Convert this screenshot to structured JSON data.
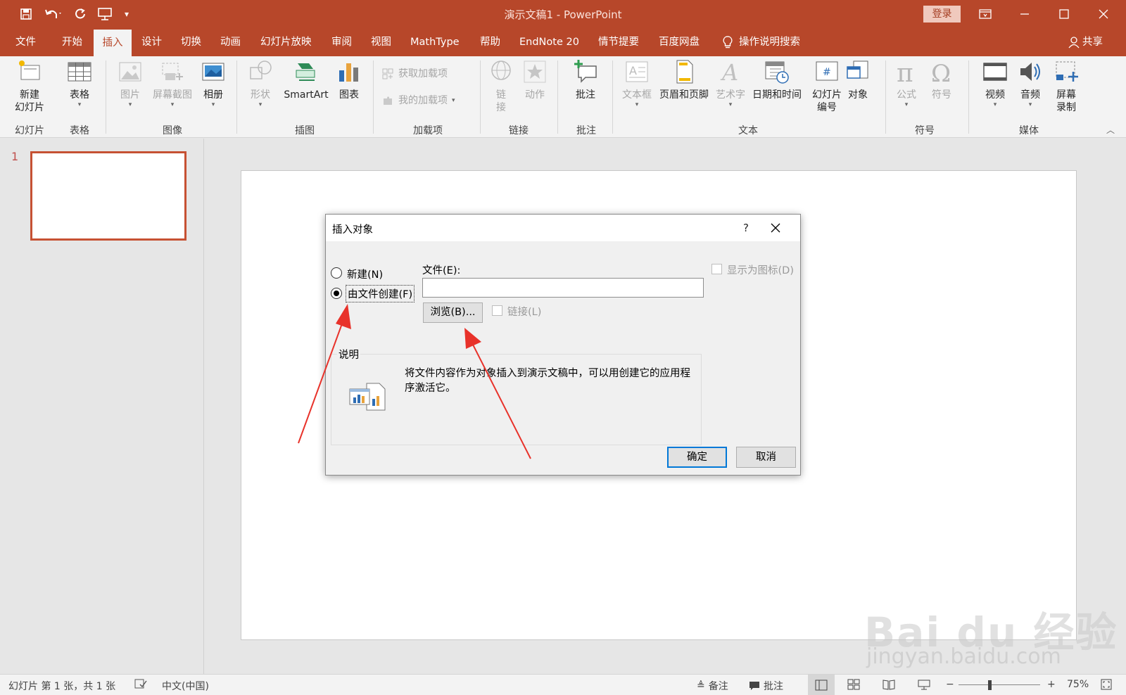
{
  "window": {
    "title": "演示文稿1  -  PowerPoint",
    "login": "登录",
    "share": "共享"
  },
  "tabs": [
    "文件",
    "开始",
    "插入",
    "设计",
    "切换",
    "动画",
    "幻灯片放映",
    "审阅",
    "视图",
    "MathType",
    "帮助",
    "EndNote 20",
    "情节提要",
    "百度网盘"
  ],
  "active_tab": "插入",
  "tell_me": "操作说明搜索",
  "ribbon": {
    "new_slide": "新建\n幻灯片",
    "table": "表格",
    "picture": "图片",
    "screenshot": "屏幕截图",
    "album": "相册",
    "shapes": "形状",
    "smartart": "SmartArt",
    "chart": "图表",
    "get_addins": "获取加载项",
    "my_addins": "我的加载项",
    "link": "链\n接",
    "action": "动作",
    "comment": "批注",
    "textbox": "文本框",
    "header_footer": "页眉和页脚",
    "wordart": "艺术字",
    "datetime": "日期和时间",
    "slide_number": "幻灯片\n编号",
    "object": "对象",
    "equation": "公式",
    "symbol": "符号",
    "video": "视频",
    "audio": "音频",
    "screen_recording": "屏幕\n录制",
    "groups": {
      "slides": "幻灯片",
      "tables": "表格",
      "images": "图像",
      "illustrations": "插图",
      "addins": "加载项",
      "links": "链接",
      "comments": "批注",
      "text": "文本",
      "symbols": "符号",
      "media": "媒体"
    }
  },
  "thumbnail": {
    "number": "1"
  },
  "dialog": {
    "title": "插入对象",
    "help": "?",
    "radio_new": "新建(N)",
    "radio_from_file": "由文件创建(F)",
    "file_label": "文件(E):",
    "file_value": "",
    "browse": "浏览(B)...",
    "link": "链接(L)",
    "display_as_icon": "显示为图标(D)",
    "desc_label": "说明",
    "desc_text": "将文件内容作为对象插入到演示文稿中，可以用创建它的应用程序激活它。",
    "ok": "确定",
    "cancel": "取消"
  },
  "watermark": {
    "logo": "Bai du 经验",
    "url": "jingyan.baidu.com"
  },
  "status": {
    "slide_info": "幻灯片 第 1 张，共 1 张",
    "language": "中文(中国)",
    "notes": "备注",
    "comments": "批注",
    "zoom": "75%"
  },
  "colors": {
    "accent": "#b7472a",
    "dialog_default_border": "#0078d7",
    "arrow": "#e8322a"
  }
}
